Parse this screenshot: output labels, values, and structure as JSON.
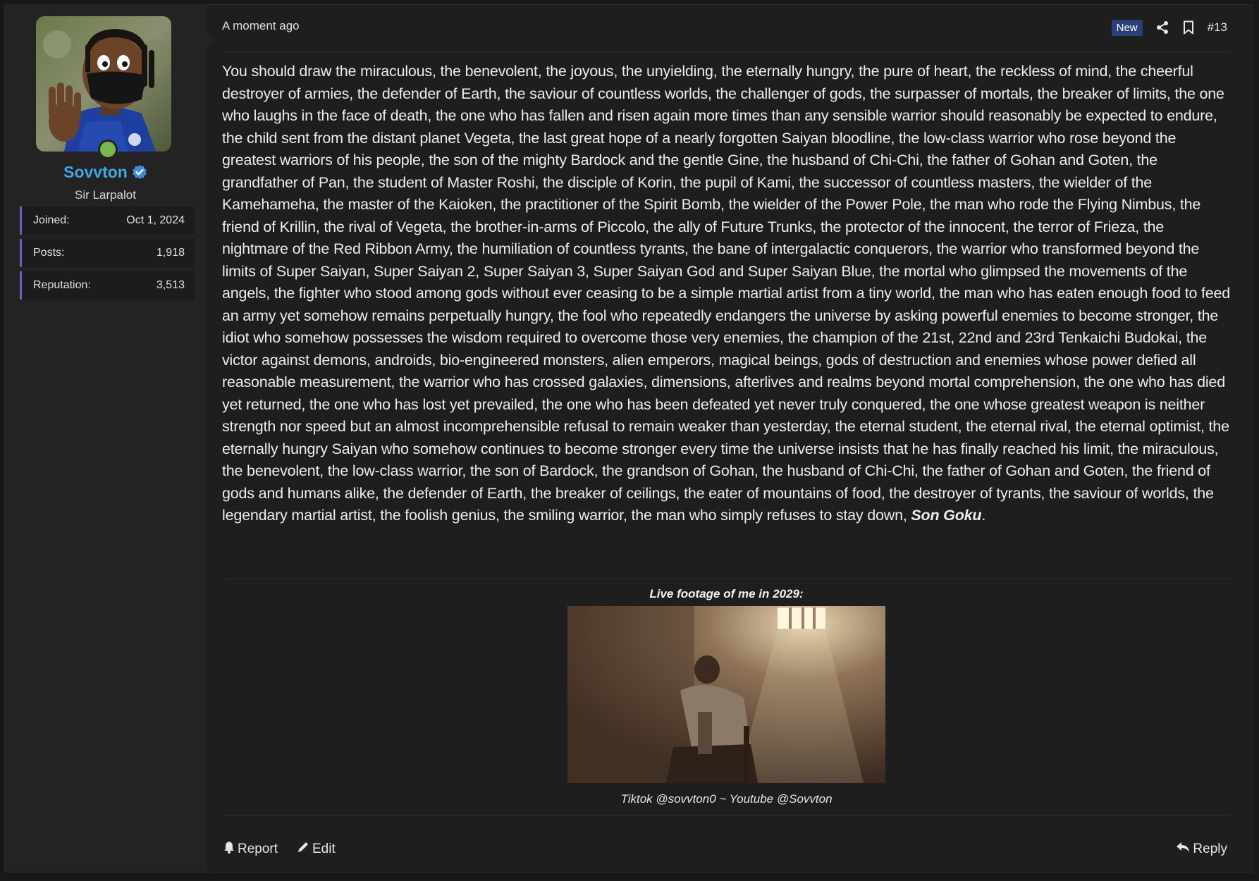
{
  "author": {
    "username": "Sovvton",
    "title": "Sir Larpalot",
    "online": true,
    "verified": true,
    "username_color": "#3fa7e0",
    "stats": [
      {
        "label": "Joined:",
        "value": "Oct 1, 2024"
      },
      {
        "label": "Posts:",
        "value": "1,918"
      },
      {
        "label": "Reputation:",
        "value": "3,513"
      }
    ]
  },
  "post": {
    "timestamp": "A moment ago",
    "badge": "New",
    "number": "#13",
    "body": "You should draw the miraculous, the benevolent, the joyous, the unyielding, the eternally hungry, the pure of heart, the reckless of mind, the cheerful destroyer of armies, the defender of Earth, the saviour of countless worlds, the challenger of gods, the surpasser of mortals, the breaker of limits, the one who laughs in the face of death, the one who has fallen and risen again more times than any sensible warrior should reasonably be expected to endure, the child sent from the distant planet Vegeta, the last great hope of a nearly forgotten Saiyan bloodline, the low-class warrior who rose beyond the greatest warriors of his people, the son of the mighty Bardock and the gentle Gine, the husband of Chi-Chi, the father of Gohan and Goten, the grandfather of Pan, the student of Master Roshi, the disciple of Korin, the pupil of Kami, the successor of countless masters, the wielder of the Kamehameha, the master of the Kaioken, the practitioner of the Spirit Bomb, the wielder of the Power Pole, the man who rode the Flying Nimbus, the friend of Krillin, the rival of Vegeta, the brother-in-arms of Piccolo, the ally of Future Trunks, the protector of the innocent, the terror of Frieza, the nightmare of the Red Ribbon Army, the humiliation of countless tyrants, the bane of intergalactic conquerors, the warrior who transformed beyond the limits of Super Saiyan, Super Saiyan 2, Super Saiyan 3, Super Saiyan God and Super Saiyan Blue, the mortal who glimpsed the movements of the angels, the fighter who stood among gods without ever ceasing to be a simple martial artist from a tiny world, the man who has eaten enough food to feed an army yet somehow remains perpetually hungry, the fool who repeatedly endangers the universe by asking powerful enemies to become stronger, the idiot who somehow possesses the wisdom required to overcome those very enemies, the champion of the 21st, 22nd and 23rd Tenkaichi Budokai, the victor against demons, androids, bio-engineered monsters, alien emperors, magical beings, gods of destruction and enemies whose power defied all reasonable measurement, the warrior who has crossed galaxies, dimensions, afterlives and realms beyond mortal comprehension, the one who has died yet returned, the one who has lost yet prevailed, the one who has been defeated yet never truly conquered, the one whose greatest weapon is neither strength nor speed but an almost incomprehensible refusal to remain weaker than yesterday, the eternal student, the eternal rival, the eternal optimist, the eternally hungry Saiyan who somehow continues to become stronger every time the universe insists that he has finally reached his limit, the miraculous, the benevolent, the low-class warrior, the son of Bardock, the grandson of Gohan, the husband of Chi-Chi, the father of Gohan and Goten, the friend of gods and humans alike, the defender of Earth, the breaker of ceilings, the eater of mountains of food, the destroyer of tyrants, the saviour of worlds, the legendary martial artist, the foolish genius, the smiling warrior, the man who simply refuses to stay down, ",
    "body_emphasis": "Son Goku",
    "body_end": "."
  },
  "signature": {
    "label": "Live footage of me in 2029:",
    "caption": "Tiktok @sovvton0 ~ Youtube @Sovvton"
  },
  "actions": {
    "report": "Report",
    "edit": "Edit",
    "reply": "Reply"
  },
  "icons": {
    "share": "share-icon",
    "bookmark": "bookmark-icon",
    "report": "bell-icon",
    "edit": "pencil-icon",
    "reply": "reply-arrow-icon",
    "verified": "verified-check-icon"
  }
}
